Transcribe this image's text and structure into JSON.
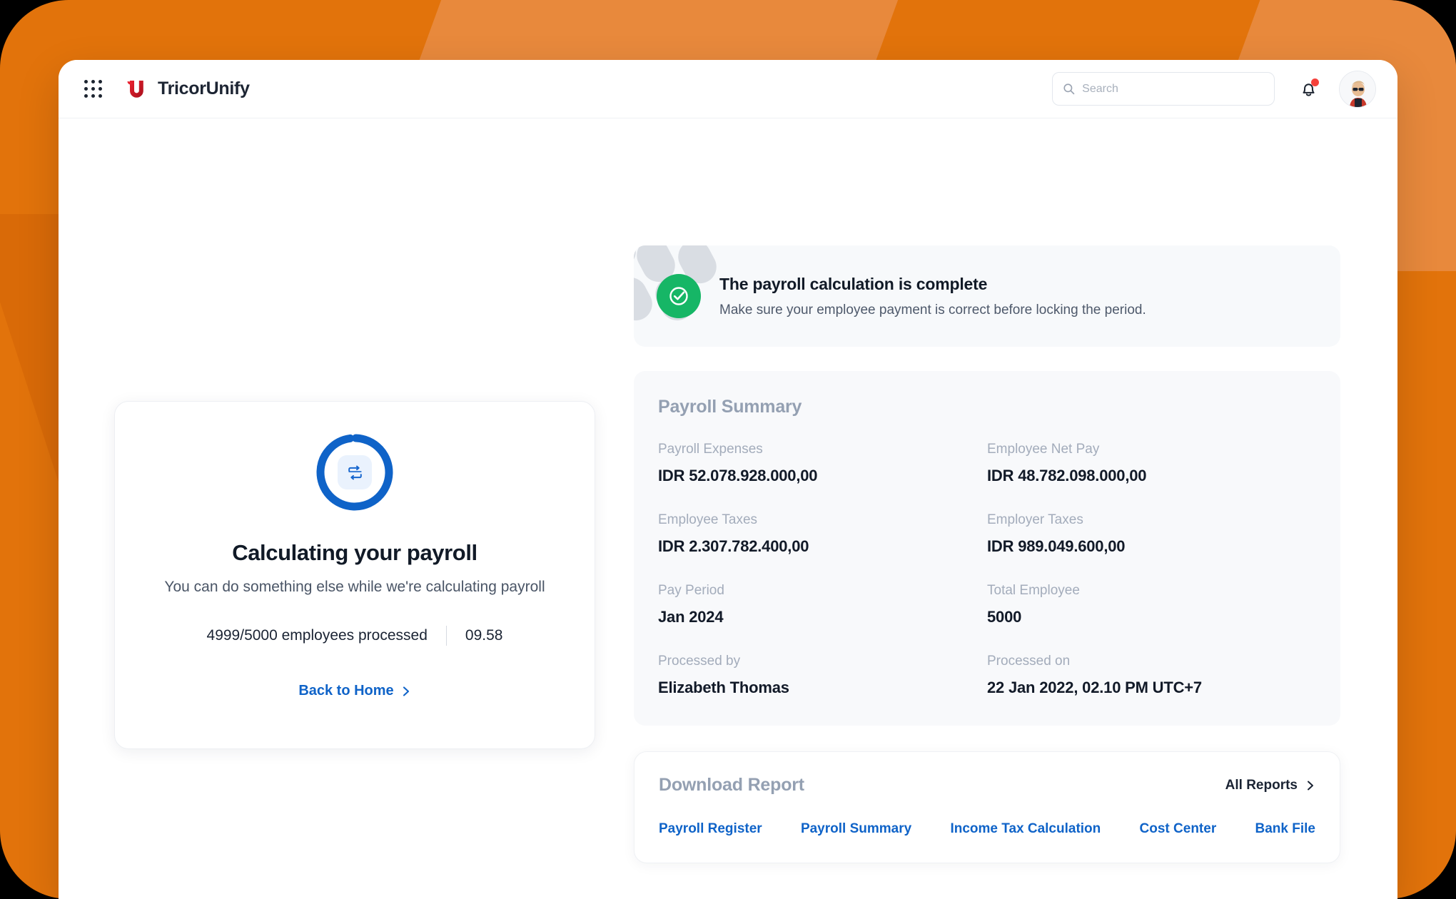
{
  "theme": {
    "background_orange": "#E2730B",
    "background_orange_light": "#E8893C",
    "accent_blue": "#0F63C8",
    "success_green": "#16B666",
    "brand_red": "#D4182A",
    "alert_dot_red": "#F5413B"
  },
  "topbar": {
    "apps_icon": "grid-apps-icon",
    "logo_icon": "tricorunify-logo-icon",
    "brand": "TricorUnify",
    "search": {
      "icon": "search-icon",
      "placeholder": "Search",
      "value": ""
    },
    "notifications_icon": "bell-icon",
    "notifications_badge": true,
    "avatar_icon": "user-avatar"
  },
  "calculating": {
    "spinner_icon": "progress-ring-icon",
    "inner_icon": "repeat-sync-icon",
    "title": "Calculating your payroll",
    "subtitle": "You can do something else while we're calculating payroll",
    "progress_text": "4999/5000 employees processed",
    "elapsed_time": "09.58",
    "back_link": "Back to Home",
    "back_link_icon": "chevron-right-icon",
    "progress_percent": 97
  },
  "alert": {
    "icon": "check-circle-icon",
    "title": "The payroll calculation is complete",
    "description": "Make sure your employee payment is correct before locking the period."
  },
  "summary": {
    "heading": "Payroll Summary",
    "items": [
      {
        "label": "Payroll Expenses",
        "value": "IDR 52.078.928.000,00"
      },
      {
        "label": "Employee Net Pay",
        "value": "IDR 48.782.098.000,00"
      },
      {
        "label": "Employee Taxes",
        "value": "IDR 2.307.782.400,00"
      },
      {
        "label": "Employer Taxes",
        "value": "IDR 989.049.600,00"
      },
      {
        "label": "Pay Period",
        "value": "Jan 2024"
      },
      {
        "label": "Total Employee",
        "value": "5000"
      },
      {
        "label": "Processed by",
        "value": "Elizabeth Thomas"
      },
      {
        "label": "Processed on",
        "value": "22 Jan 2022, 02.10 PM UTC+7"
      }
    ]
  },
  "reports": {
    "heading": "Download Report",
    "all_reports_label": "All Reports",
    "all_reports_icon": "chevron-right-icon",
    "links": [
      "Payroll Register",
      "Payroll Summary",
      "Income Tax Calculation",
      "Cost Center",
      "Bank File"
    ]
  }
}
